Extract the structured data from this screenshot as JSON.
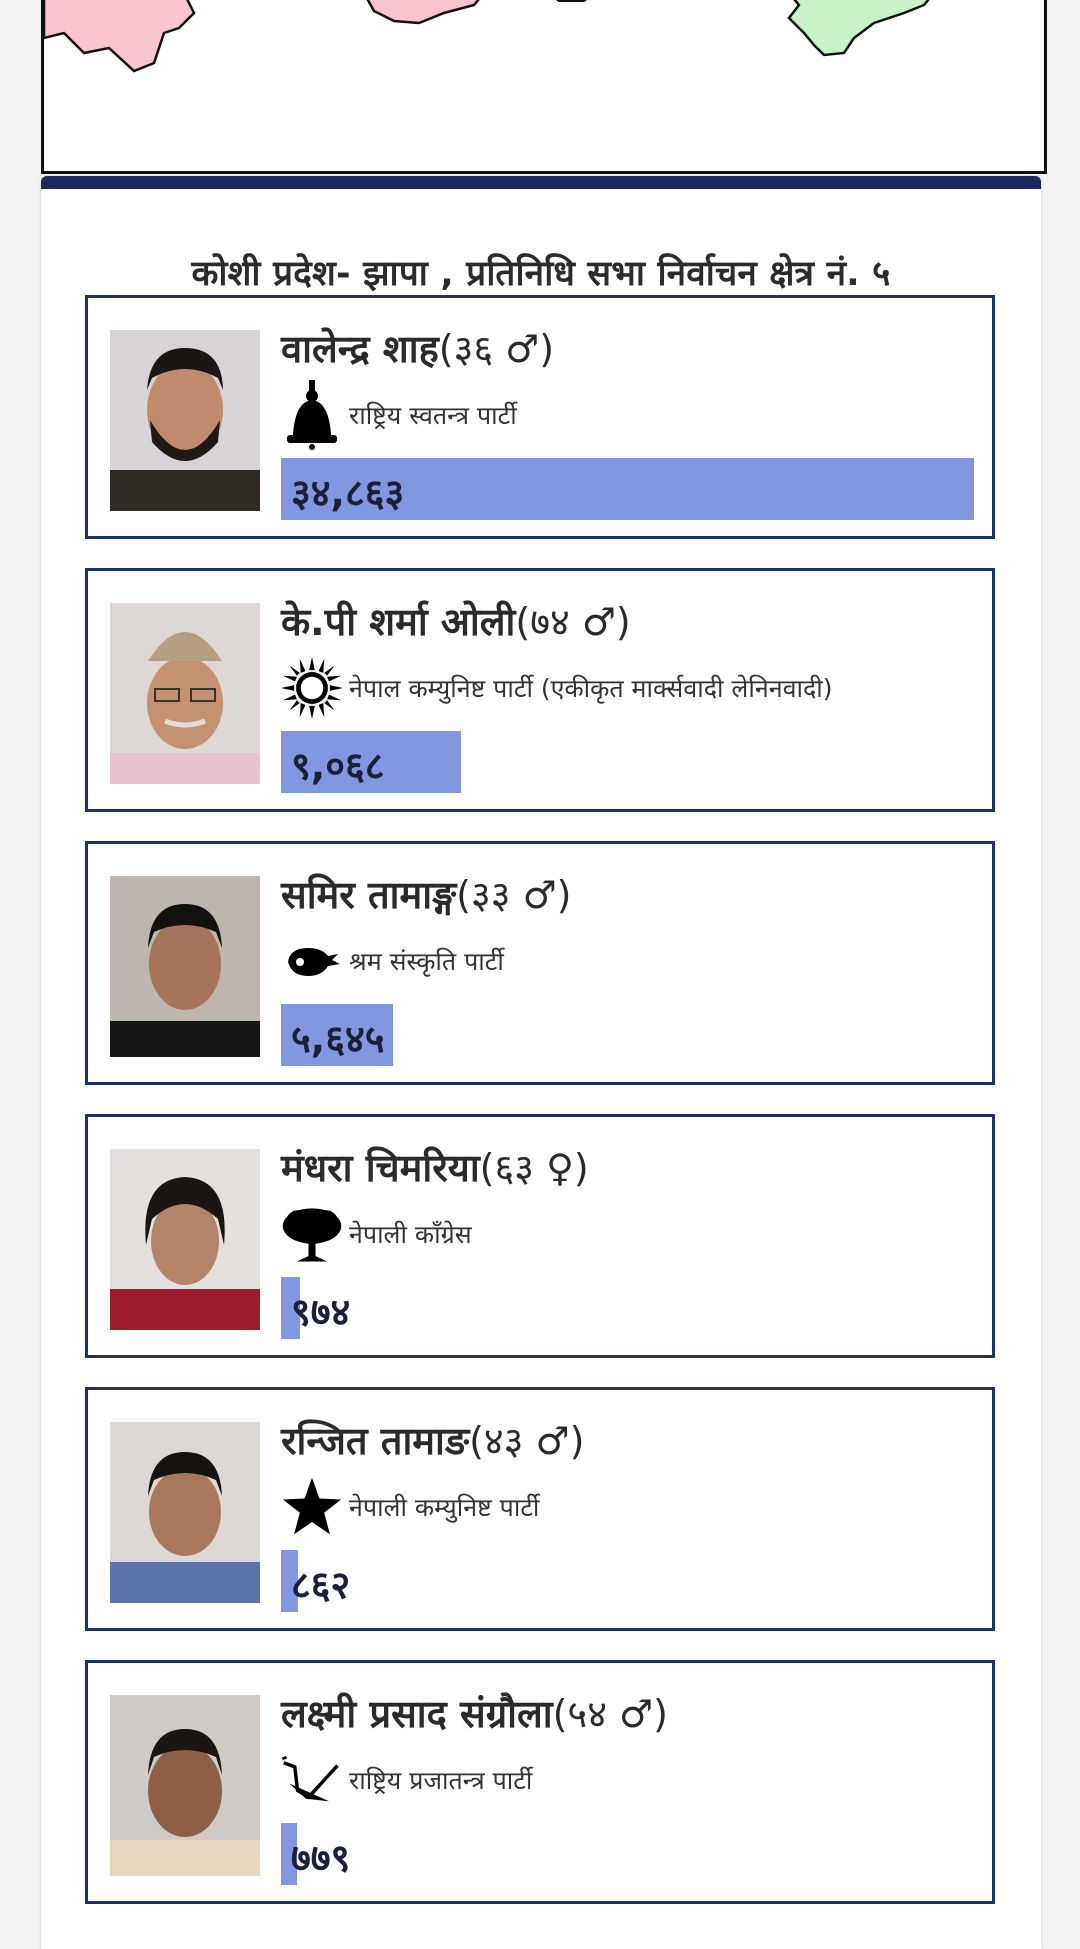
{
  "title": "कोशी प्रदेश- झापा , प्रतिनिधि सभा निर्वाचन क्षेत्र नं. ५",
  "accent_color": "#1b2a5e",
  "bar_color": "#8197e0",
  "map_colors": [
    "#f9c6cf",
    "#f7c3cd",
    "#c9f2c9"
  ],
  "candidates": [
    {
      "name": "वालेन्द्र शाह",
      "age": "(३६ ♂)",
      "party": "राष्ट्रिय स्वतन्त्र पार्टी",
      "symbol": "bell-icon",
      "votes": "३४,८६३",
      "vote_count": 34863,
      "bar_fraction": 1.0
    },
    {
      "name": "के.पी शर्मा ओली",
      "age": "(७४ ♂)",
      "party": "नेपाल कम्युनिष्ट पार्टी (एकीकृत मार्क्सवादी लेनिनवादी)",
      "symbol": "sun-icon",
      "votes": "९,०६८",
      "vote_count": 9068,
      "bar_fraction": 0.26
    },
    {
      "name": "समिर तामाङ्ग",
      "age": "(३३ ♂)",
      "party": "श्रम संस्कृति पार्टी",
      "symbol": "hand-icon",
      "votes": "५,६४५",
      "vote_count": 5645,
      "bar_fraction": 0.162
    },
    {
      "name": "मंधरा चिमरिया",
      "age": "(६३ ♀)",
      "party": "नेपाली काँग्रेस",
      "symbol": "tree-icon",
      "votes": "९७४",
      "vote_count": 974,
      "bar_fraction": 0.028
    },
    {
      "name": "रन्जित तामाङ",
      "age": "(४३ ♂)",
      "party": "नेपाली कम्युनिष्ट पार्टी",
      "symbol": "star-icon",
      "votes": "८६२",
      "vote_count": 862,
      "bar_fraction": 0.025
    },
    {
      "name": "लक्ष्मी प्रसाद संग्रौला",
      "age": "(५४ ♂)",
      "party": "राष्ट्रिय प्रजातन्त्र पार्टी",
      "symbol": "plough-icon",
      "votes": "७७९",
      "vote_count": 779,
      "bar_fraction": 0.022
    }
  ]
}
